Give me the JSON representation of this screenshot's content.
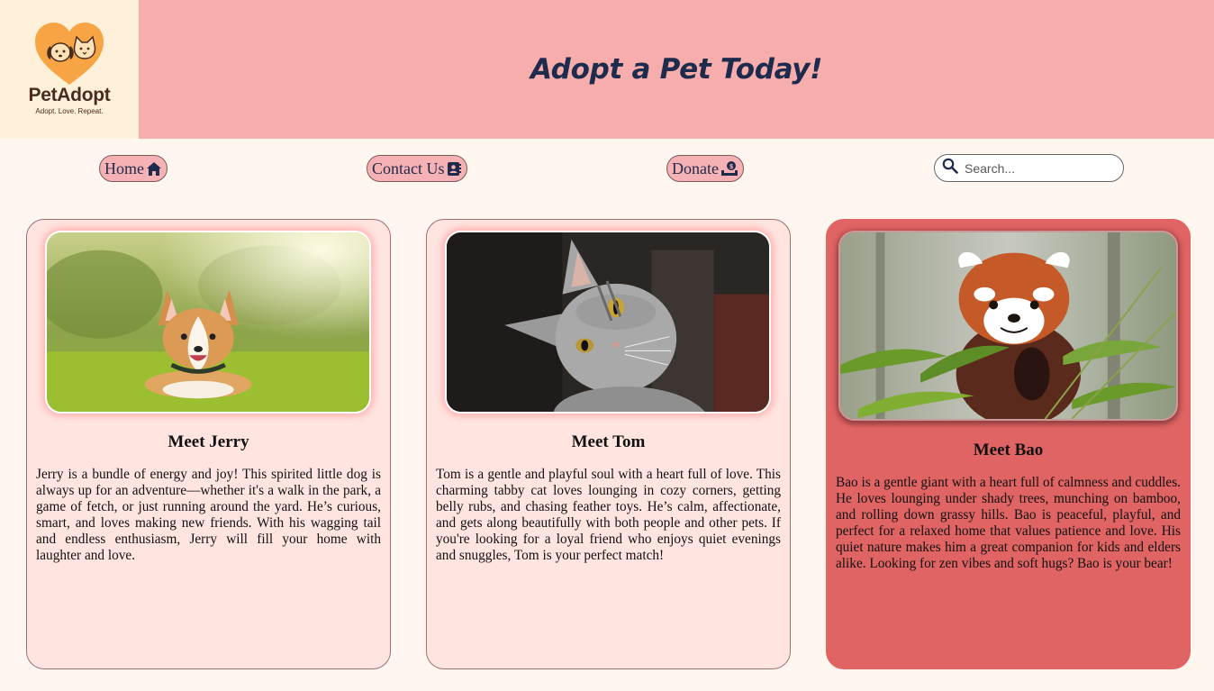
{
  "logo": {
    "name": "PetAdopt",
    "tagline": "Adopt. Love. Repeat."
  },
  "header": {
    "title": "Adopt a Pet Today!"
  },
  "nav": {
    "home_label": "Home",
    "contact_label": "Contact Us",
    "donate_label": "Donate"
  },
  "search": {
    "placeholder": "Search..."
  },
  "cards": [
    {
      "title": "Meet Jerry",
      "description": "Jerry is a bundle of energy and joy! This spirited little dog is always up for an adventure—whether it's a walk in the park, a game of fetch, or just running around the yard. He’s curious, smart, and loves making new friends. With his wagging tail and endless enthusiasm, Jerry will fill your home with laughter and love."
    },
    {
      "title": "Meet Tom",
      "description": "Tom is a gentle and playful soul with a heart full of love. This charming tabby cat loves lounging in cozy corners, getting belly rubs, and chasing feather toys. He’s calm, affectionate, and gets along beautifully with both people and other pets. If you're looking for a loyal friend who enjoys quiet evenings and snuggles, Tom is your perfect match!"
    },
    {
      "title": "Meet Bao",
      "description": "Bao is a gentle giant with a heart full of calmness and cuddles. He loves lounging under shady trees, munching on bamboo, and rolling down grassy hills. Bao is peaceful, playful, and perfect for a relaxed home that values patience and love. His quiet nature makes him a great companion for kids and elders alike. Looking for zen vibes and soft hugs? Bao is your bear!"
    }
  ],
  "colors": {
    "banner": "#f8adad",
    "title_text": "#1d2b4c",
    "card_bg": "#ffe4e0",
    "card_active_bg": "#e06464",
    "page_bg": "#fff6f0"
  }
}
